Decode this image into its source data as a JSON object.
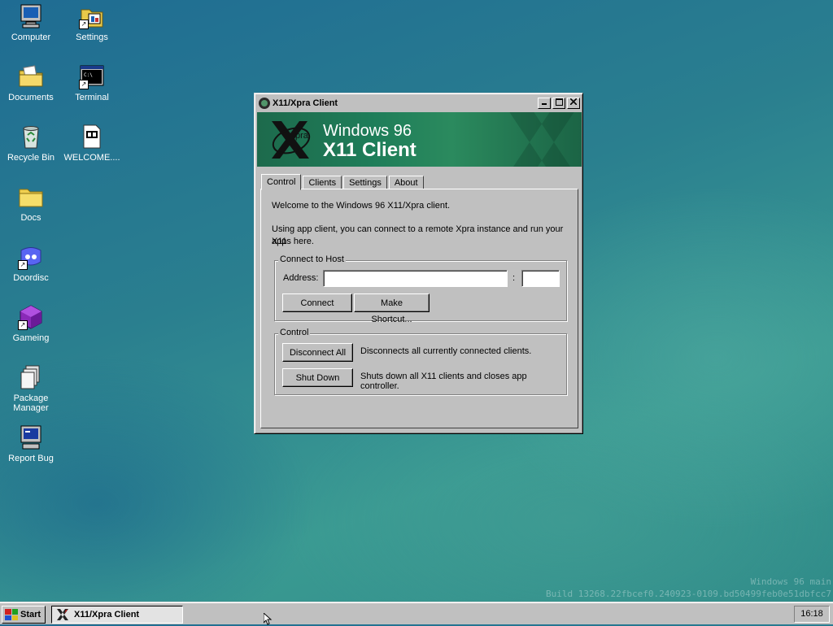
{
  "desktop": {
    "icons": [
      {
        "label": "Computer",
        "icon": "computer-icon"
      },
      {
        "label": "Settings",
        "icon": "settings-icon"
      },
      {
        "label": "Documents",
        "icon": "documents-folder-icon"
      },
      {
        "label": "Terminal",
        "icon": "terminal-icon"
      },
      {
        "label": "Recycle Bin",
        "icon": "recycle-bin-icon"
      },
      {
        "label": "WELCOME....",
        "icon": "welcome-document-icon"
      },
      {
        "label": "Docs",
        "icon": "folder-icon"
      },
      {
        "label": "Doordisc",
        "icon": "doordisc-icon"
      },
      {
        "label": "Gameing",
        "icon": "gameing-icon"
      },
      {
        "label": "Package Manager",
        "icon": "package-manager-icon"
      },
      {
        "label": "Report Bug",
        "icon": "report-bug-icon"
      }
    ]
  },
  "window": {
    "title": "X11/Xpra Client",
    "banner_line1": "Windows 96",
    "banner_line2": "X11 Client",
    "banner_logo_text": "pra",
    "tabs": [
      {
        "label": "Control",
        "active": true
      },
      {
        "label": "Clients",
        "active": false
      },
      {
        "label": "Settings",
        "active": false
      },
      {
        "label": "About",
        "active": false
      }
    ],
    "control": {
      "welcome_text": "Welcome to the Windows 96 X11/Xpra client.",
      "intro_text_line1": "Using app client, you can connect to a remote Xpra instance and run your X11",
      "intro_text_line2": "apps here.",
      "connect_group_label": "Connect to Host",
      "address_label": "Address:",
      "address_value": "",
      "port_separator": ":",
      "port_value": "",
      "connect_button": "Connect",
      "make_shortcut_button": "Make Shortcut...",
      "control_group_label": "Control",
      "disconnect_all_button": "Disconnect All",
      "disconnect_all_desc": "Disconnects all currently connected clients.",
      "shut_down_button": "Shut Down",
      "shut_down_desc": "Shuts down all X11 clients and closes app controller."
    }
  },
  "watermark": {
    "line1": "Windows 96 main",
    "line2": "Build 13268.22fbcef0.240923-0109.bd50499feb0e51dbfcc7"
  },
  "taskbar": {
    "start_label": "Start",
    "task_label": "X11/Xpra Client",
    "clock": "16:18"
  }
}
